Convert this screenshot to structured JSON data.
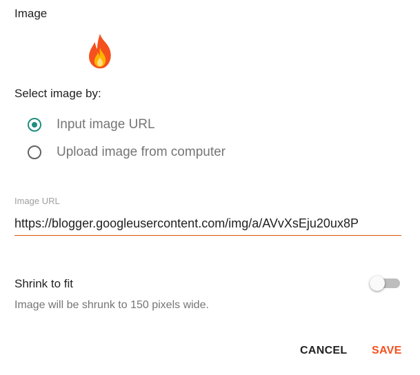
{
  "dialog": {
    "section_title": "Image",
    "preview": {
      "icon": "fire-icon"
    },
    "select_label": "Select image by:",
    "options": [
      {
        "label": "Input image URL",
        "checked": true
      },
      {
        "label": "Upload image from computer",
        "checked": false
      }
    ],
    "url_field": {
      "label": "Image URL",
      "value": "https://blogger.googleusercontent.com/img/a/AVvXsEju20ux8P"
    },
    "shrink": {
      "label": "Shrink to fit",
      "enabled": false,
      "help": "Image will be shrunk to 150 pixels wide."
    },
    "buttons": {
      "cancel": "CANCEL",
      "save": "SAVE"
    }
  },
  "colors": {
    "accent_teal": "#1e8e7e",
    "accent_orange": "#f4511e",
    "underline": "#e65100"
  }
}
